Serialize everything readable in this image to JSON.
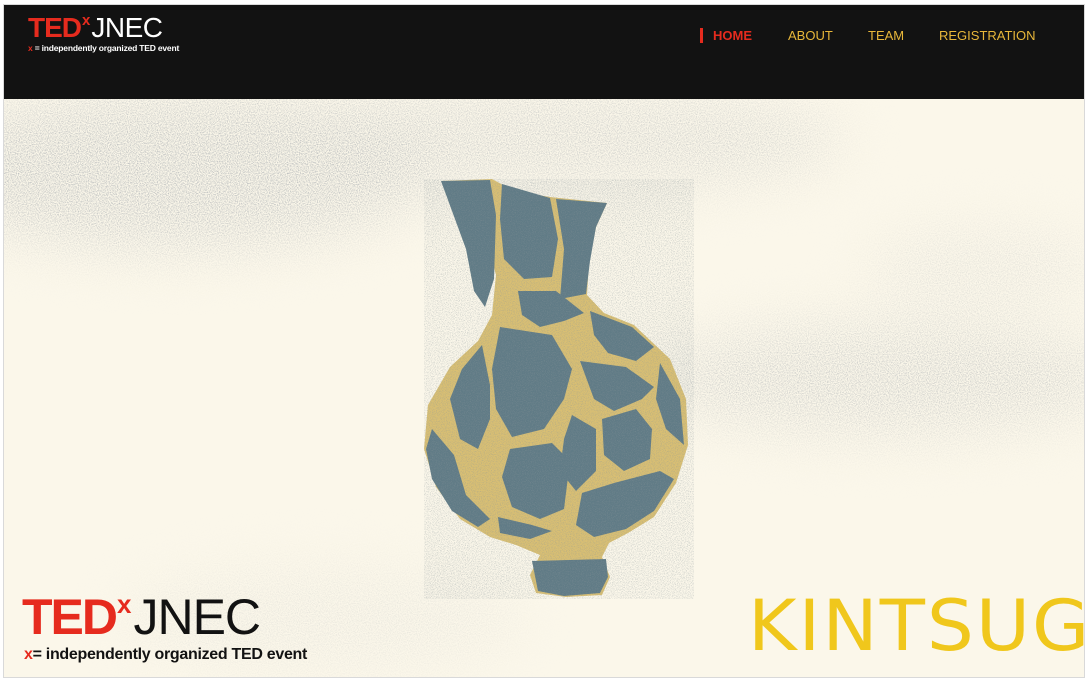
{
  "header": {
    "logo": {
      "ted": "TED",
      "x": "x",
      "name": "JNEC",
      "tagline_x": "x",
      "tagline": "= independently organized TED event"
    },
    "nav": [
      {
        "label": "HOME",
        "active": true
      },
      {
        "label": "ABOUT",
        "active": false
      },
      {
        "label": "TEAM",
        "active": false
      },
      {
        "label": "REGISTRATION",
        "active": false
      }
    ]
  },
  "hero": {
    "logo": {
      "ted": "TED",
      "x": "x",
      "name": "JNEC",
      "tagline_x": "x",
      "tagline": "= independently organized TED event"
    },
    "theme": "KINTSUGI",
    "illustration": "kintsugi-vase-illustration"
  },
  "colors": {
    "ted_red": "#e62b1e",
    "nav_gold": "#e8b73a",
    "header_bg": "#121212",
    "hero_bg": "#fbf7ea",
    "vase_blue": "#5f7a84",
    "gold_seam": "#d9bf73",
    "kintsugi_yellow": "#f0c71c"
  }
}
